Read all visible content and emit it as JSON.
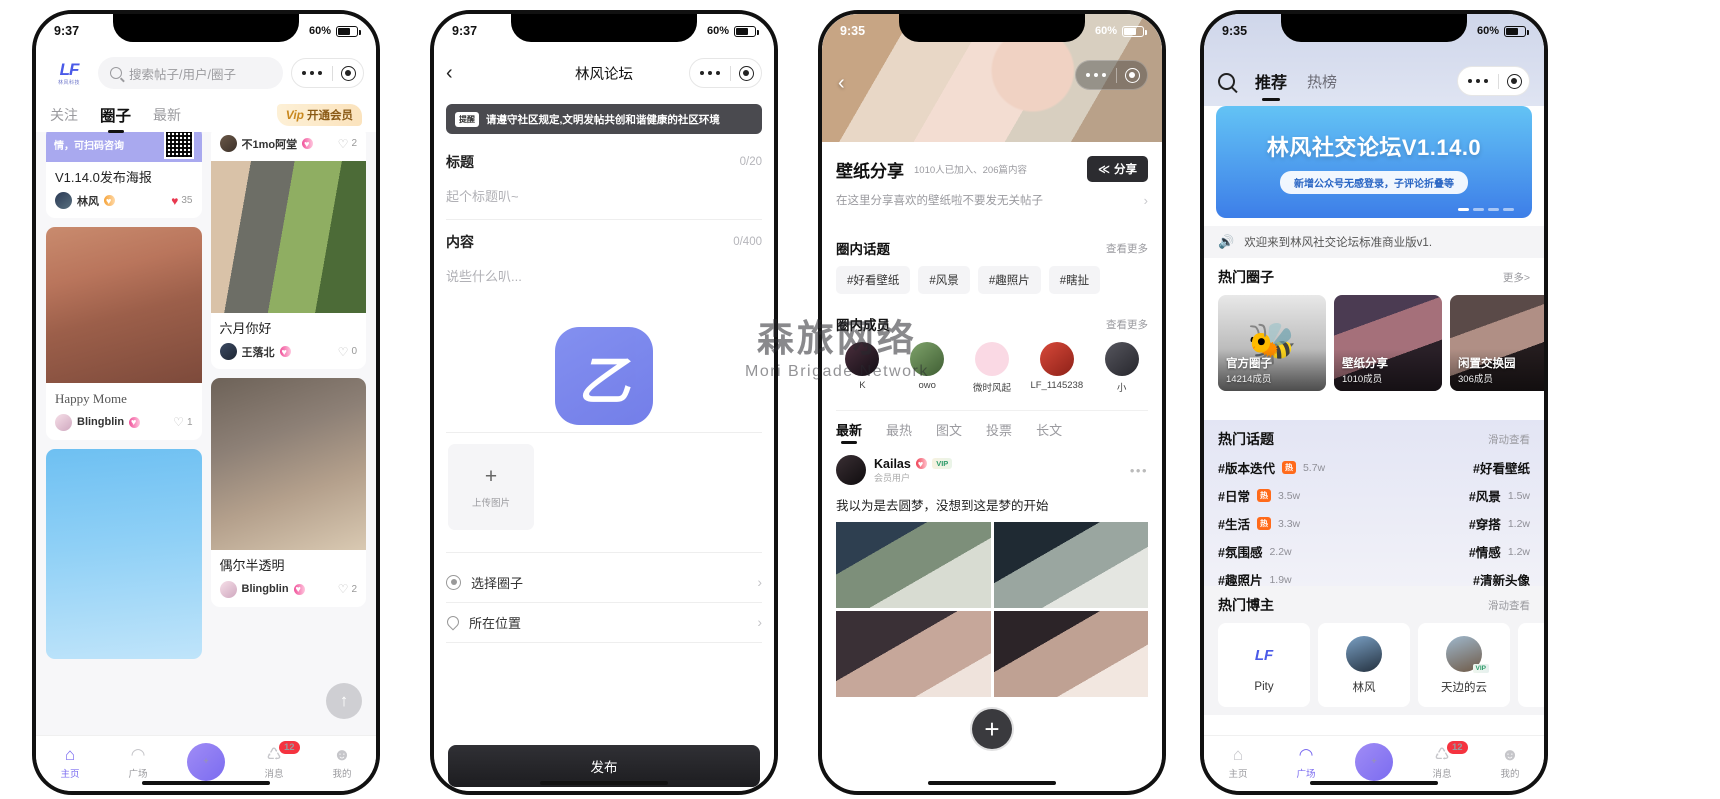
{
  "watermark": {
    "cn": "森旅网络",
    "en": "Mori Brigade Network"
  },
  "phone1": {
    "status": {
      "time": "9:37",
      "battery": "60%"
    },
    "logo": {
      "mark": "LF",
      "sub": "林风科技"
    },
    "search_placeholder": "搜索帖子/用户/圈子",
    "tabs": [
      {
        "label": "关注",
        "active": false
      },
      {
        "label": "圈子",
        "active": true
      },
      {
        "label": "最新",
        "active": false
      }
    ],
    "vip_button": {
      "mark": "Vip",
      "label": "开通会员"
    },
    "ad_banner": {
      "text": "情，可扫码咨询"
    },
    "cards_left": [
      {
        "title": "V1.14.0发布海报",
        "user": "林风",
        "likes": "35",
        "liked": true,
        "level_color": "#f6a43a"
      },
      {
        "title": "Happy Mome",
        "user": "Blingblin",
        "likes": "1",
        "liked": false,
        "level_color": "#f0539b",
        "serif": true
      }
    ],
    "cards_right": [
      {
        "title": "",
        "user": "不1mo阿堂",
        "likes": "2",
        "liked": false,
        "level_color": "#f0539b"
      },
      {
        "title": "六月你好",
        "user": "王落北",
        "likes": "0",
        "liked": false,
        "level_color": "#f0539b"
      },
      {
        "title": "偶尔半透明",
        "user": "Blingblin",
        "likes": "2",
        "liked": false,
        "level_color": "#f0539b"
      }
    ],
    "scroll_top_icon": "↑",
    "tabbar": [
      {
        "label": "主页",
        "icon": "home-icon",
        "glyph": "⌂",
        "active": true,
        "badge": ""
      },
      {
        "label": "广场",
        "icon": "plaza-icon",
        "glyph": "◠",
        "active": false,
        "badge": ""
      },
      {
        "label": "",
        "icon": "add-post-icon",
        "glyph": "+",
        "active": false,
        "badge": ""
      },
      {
        "label": "消息",
        "icon": "bell-icon",
        "glyph": "♺",
        "active": false,
        "badge": "12"
      },
      {
        "label": "我的",
        "icon": "profile-icon",
        "glyph": "☻",
        "active": false,
        "badge": ""
      }
    ]
  },
  "phone2": {
    "status": {
      "time": "9:37",
      "battery": "60%"
    },
    "nav_title": "林风论坛",
    "back_icon": "back-chevron-icon",
    "tip": {
      "tag": "提醒",
      "text": "请遵守社区规定,文明发帖共创和谐健康的社区环境"
    },
    "title_field": {
      "label": "标题",
      "counter": "0/20",
      "placeholder": "起个标题叭~"
    },
    "content_field": {
      "label": "内容",
      "counter": "0/400",
      "placeholder": "说些什么叭..."
    },
    "upload": {
      "plus": "+",
      "label": "上传图片"
    },
    "options": [
      {
        "label": "选择圈子",
        "icon": "circle-select-icon"
      },
      {
        "label": "所在位置",
        "icon": "location-pin-icon"
      }
    ],
    "publish_label": "发布"
  },
  "phone3": {
    "status": {
      "time": "9:35",
      "battery": "60%"
    },
    "circle": {
      "name": "壁纸分享",
      "stats": "1010人已加入、206篇内容",
      "share_label": "分享",
      "share_icon": "share-icon",
      "desc": "在这里分享喜欢的壁纸啦不要发无关帖子"
    },
    "topics_section": {
      "title": "圈内话题",
      "more": "查看更多"
    },
    "topics": [
      "#好看壁纸",
      "#风景",
      "#趣照片",
      "#瞎扯"
    ],
    "members_section": {
      "title": "圈内成员",
      "more": "查看更多"
    },
    "members": [
      {
        "name": "K",
        "color": "#2f2a3a"
      },
      {
        "name": "ᴏᴡᴏ",
        "color": "#5d8f55"
      },
      {
        "name": "微时风起",
        "color": "#fad9e4"
      },
      {
        "name": "LF_1145238",
        "color": "#c23b2e"
      },
      {
        "name": "小",
        "color": "#4a4a52"
      }
    ],
    "post_tabs": [
      {
        "label": "最新",
        "active": true
      },
      {
        "label": "最热",
        "active": false
      },
      {
        "label": "图文",
        "active": false
      },
      {
        "label": "投票",
        "active": false
      },
      {
        "label": "长文",
        "active": false
      }
    ],
    "post": {
      "author": "Kailas",
      "role": "会员用户",
      "vip": "VIP",
      "text": "我以为是去圆梦，没想到这是梦的开始",
      "more_icon": "more-dots-icon"
    },
    "fab_icon": "add-plus-icon"
  },
  "phone4": {
    "status": {
      "time": "9:35",
      "battery": "60%"
    },
    "search_icon": "search-icon",
    "tabs": [
      {
        "label": "推荐",
        "active": true
      },
      {
        "label": "热榜",
        "active": false
      }
    ],
    "banner": {
      "title": "林风社交论坛V1.14.0",
      "subtitle": "新增公众号无感登录，子评论折叠等"
    },
    "notice": {
      "icon": "speaker-icon",
      "text": "欢迎来到林风社交论坛标准商业版v1."
    },
    "hot_circles": {
      "title": "热门圈子",
      "more": "更多>",
      "items": [
        {
          "name": "官方圈子",
          "members": "14214成员",
          "bg": "#b8b8b8"
        },
        {
          "name": "壁纸分享",
          "members": "1010成员",
          "bg": "#2c2430"
        },
        {
          "name": "闲置交换园",
          "members": "306成员",
          "bg": "#3a3038"
        }
      ]
    },
    "hot_topics": {
      "title": "热门话题",
      "more": "滑动查看",
      "items": [
        {
          "name": "#版本迭代",
          "hot": "热",
          "value": "5.7w"
        },
        {
          "name": "#好看壁纸",
          "hot": "",
          "value": ""
        },
        {
          "name": "#日常",
          "hot": "热",
          "value": "3.5w"
        },
        {
          "name": "#风景",
          "hot": "",
          "value": "1.5w"
        },
        {
          "name": "#生活",
          "hot": "热",
          "value": "3.3w"
        },
        {
          "name": "#穿搭",
          "hot": "",
          "value": "1.2w"
        },
        {
          "name": "#氛围感",
          "hot": "",
          "value": "2.2w"
        },
        {
          "name": "#情感",
          "hot": "",
          "value": "1.2w"
        },
        {
          "name": "#趣照片",
          "hot": "",
          "value": "1.9w"
        },
        {
          "name": "#清新头像",
          "hot": "",
          "value": ""
        }
      ]
    },
    "hot_bloggers": {
      "title": "热门博主",
      "more": "滑动查看",
      "items": [
        {
          "name": "Pity",
          "type": "logo"
        },
        {
          "name": "林风",
          "type": "photo"
        },
        {
          "name": "天边的云",
          "type": "photo",
          "vip": "VIP"
        }
      ]
    },
    "tabbar": [
      {
        "label": "主页",
        "glyph": "⌂",
        "active": false,
        "badge": ""
      },
      {
        "label": "广场",
        "glyph": "◠",
        "active": true,
        "badge": ""
      },
      {
        "label": "",
        "glyph": "+",
        "active": false,
        "badge": ""
      },
      {
        "label": "消息",
        "glyph": "♺",
        "active": false,
        "badge": "12"
      },
      {
        "label": "我的",
        "glyph": "☻",
        "active": false,
        "badge": ""
      }
    ]
  }
}
